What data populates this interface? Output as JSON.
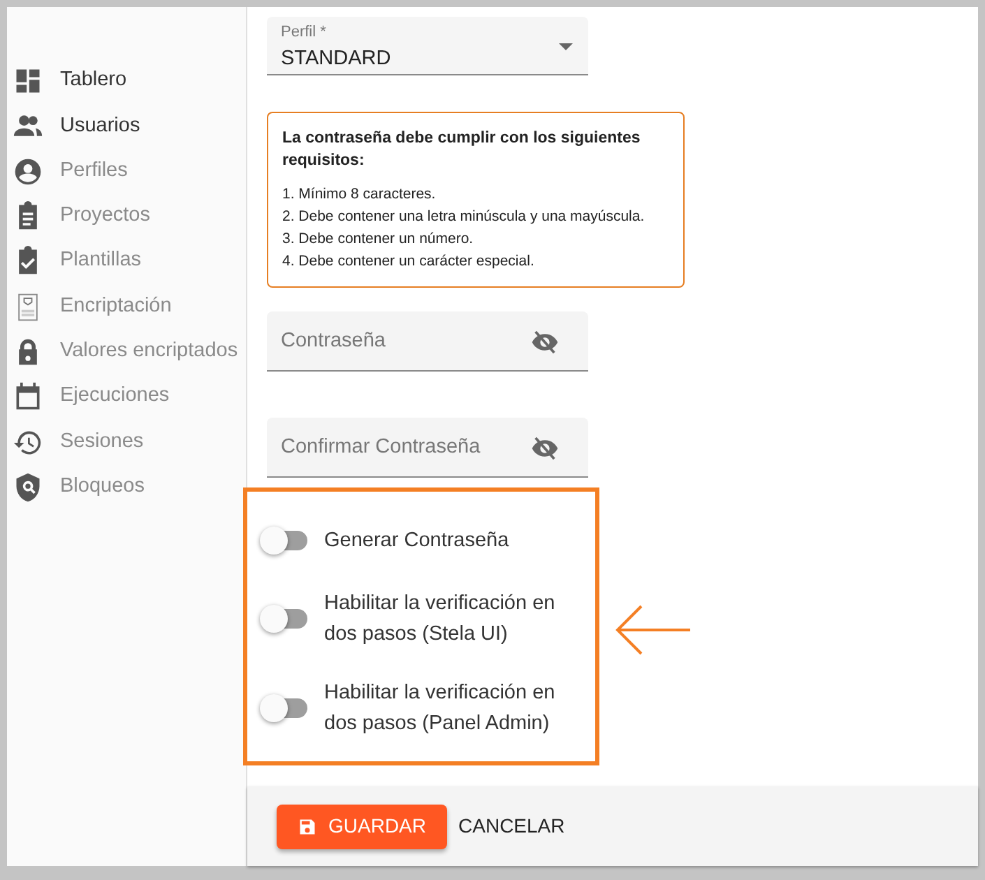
{
  "sidebar": {
    "items": [
      {
        "label": "Tablero",
        "enabled": true
      },
      {
        "label": "Usuarios",
        "enabled": true
      },
      {
        "label": "Perfiles",
        "enabled": false
      },
      {
        "label": "Proyectos",
        "enabled": false
      },
      {
        "label": "Plantillas",
        "enabled": false
      },
      {
        "label": "Encriptación",
        "enabled": false
      },
      {
        "label": "Valores encriptados",
        "enabled": false
      },
      {
        "label": "Ejecuciones",
        "enabled": false
      },
      {
        "label": "Sesiones",
        "enabled": false
      },
      {
        "label": "Bloqueos",
        "enabled": false
      }
    ]
  },
  "profile_select": {
    "label": "Perfil *",
    "value": "STANDARD"
  },
  "requirements": {
    "title": "La contraseña debe cumplir con los siguientes requisitos:",
    "items": [
      "1. Mínimo 8 caracteres.",
      "2. Debe contener una letra minúscula y una mayúscula.",
      "3. Debe contener un número.",
      "4. Debe contener un carácter especial."
    ]
  },
  "password_fields": [
    {
      "placeholder": "Contraseña"
    },
    {
      "placeholder": "Confirmar Contraseña"
    }
  ],
  "toggles": [
    {
      "label": "Generar Contraseña",
      "on": false
    },
    {
      "label": "Habilitar la verificación en dos pasos (Stela UI)",
      "on": false
    },
    {
      "label": "Habilitar la verificación en dos pasos (Panel Admin)",
      "on": false
    }
  ],
  "buttons": {
    "save": "GUARDAR",
    "cancel": "CANCELAR"
  }
}
